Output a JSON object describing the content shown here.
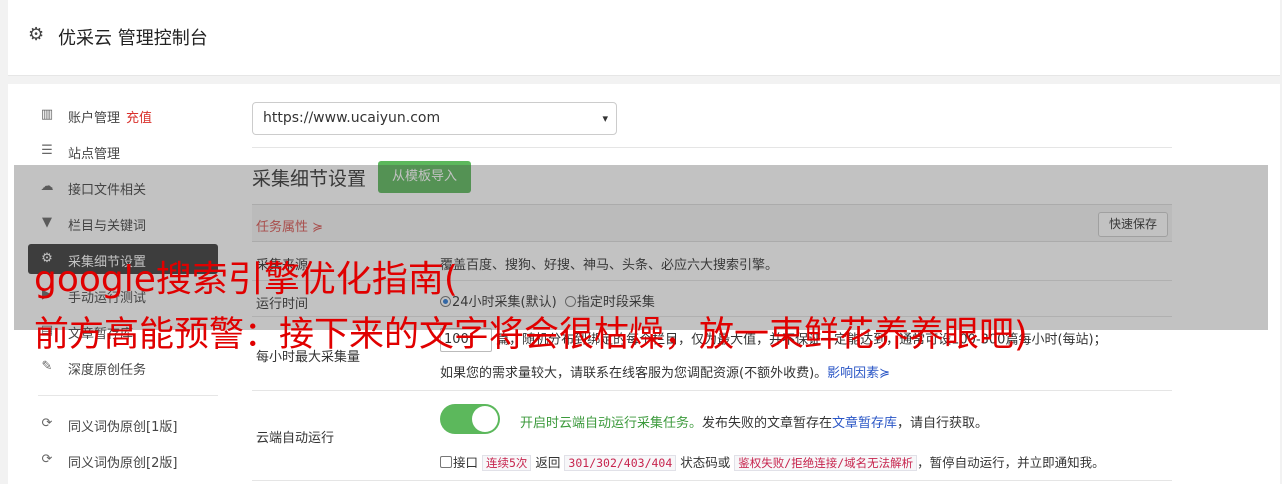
{
  "header": {
    "title": "优采云 管理控制台",
    "icon": "gear-icon"
  },
  "sidebar": {
    "items": [
      {
        "label": "账户管理",
        "extra": "充值",
        "icon": "bar-chart-icon",
        "glyph": "📊"
      },
      {
        "label": "站点管理",
        "icon": "server-icon",
        "glyph": "☰"
      },
      {
        "label": "接口文件相关",
        "icon": "cloud-upload-icon",
        "glyph": "☁"
      },
      {
        "label": "栏目与关键词",
        "icon": "filter-icon",
        "glyph": "▼"
      },
      {
        "label": "采集细节设置",
        "icon": "cogs-icon",
        "glyph": "⚙"
      },
      {
        "label": "手动运行测试",
        "icon": "play-icon",
        "glyph": "▶"
      },
      {
        "label": "文章暂存库",
        "icon": "database-icon",
        "glyph": "▤"
      },
      {
        "label": "深度原创任务",
        "icon": "edit-icon",
        "glyph": "✎"
      },
      {
        "label": "同义词伪原创[1版]",
        "icon": "refresh-icon",
        "glyph": "⟳"
      },
      {
        "label": "同义词伪原创[2版]",
        "icon": "refresh-icon",
        "glyph": "⟳"
      }
    ]
  },
  "site_select": {
    "value": "https://www.ucaiyun.com"
  },
  "section": {
    "title": "采集细节设置",
    "import_button": "从模板导入"
  },
  "panel": {
    "task_attr": "任务属性 ≽",
    "quick_save": "快速保存"
  },
  "rows": {
    "engine": {
      "label": "采集来源",
      "text": "覆盖百度、搜狗、好搜、神马、头条、必应六大搜索引擎。"
    },
    "run_time": {
      "label": "运行时间",
      "opt1": "24小时采集(默认)",
      "opt2": "指定时段采集"
    },
    "max_per_hour": {
      "label": "每小时最大采集量",
      "value": "100",
      "desc": "篇，随机分布到绑定的每个栏目，仅为最大值，并不保证一定能达到，通常可设100-300篇每小时(每站)；",
      "hint": "如果您的需求量较大，请联系在线客服为您调配资源(不额外收费)。",
      "link": "影响因素≽"
    },
    "cloud": {
      "label": "云端自动运行",
      "on_text": "开启时云端自动运行采集任务。",
      "desc1": "发布失败的文章暂存在",
      "link": "文章暂存库",
      "desc2": "，请自行获取。",
      "cb_prefix": "接口",
      "code1": "连续5次",
      "mid1": "返回",
      "code2": "301/302/403/404",
      "mid2": "状态码或",
      "code3": "鉴权失败/拒绝连接/域名无法解析",
      "tail": "，暂停自动运行，并立即通知我。"
    }
  },
  "watermark": {
    "line1": "google搜索引擎优化指南(",
    "line2": "前方高能预警：接下来的文字将会很枯燥，放一束鲜花养养眼吧)"
  }
}
